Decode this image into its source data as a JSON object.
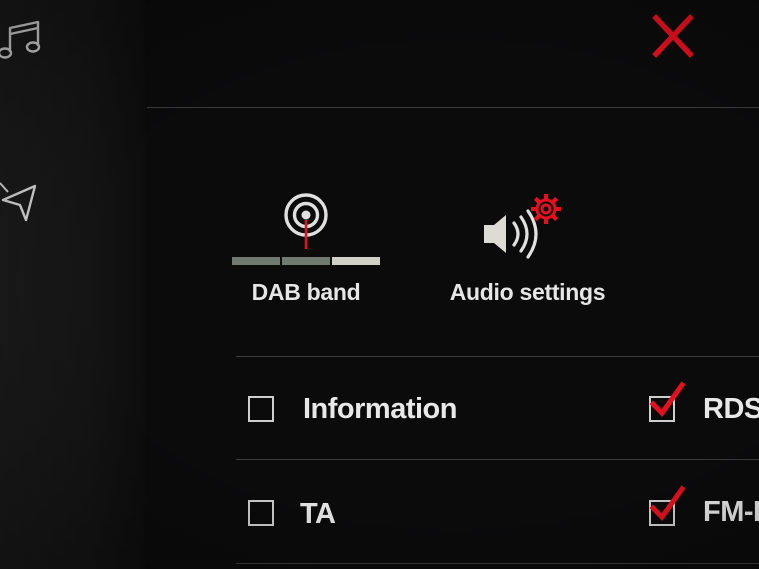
{
  "colors": {
    "accent": "#e3101e",
    "text": "#e8e8e8",
    "divider": "#3c3c3c",
    "background": "#0b0b0c"
  },
  "sidebar": {
    "icons": [
      {
        "name": "music-note-icon"
      },
      {
        "name": "navigation-arrow-icon"
      }
    ]
  },
  "header": {
    "close_icon": "close-icon"
  },
  "tiles": [
    {
      "label": "DAB band",
      "icon": "radio-antenna-icon"
    },
    {
      "label": "Audio settings",
      "icon": "speaker-settings-icon"
    }
  ],
  "options": {
    "information": {
      "label": "Information",
      "checked": false
    },
    "rds": {
      "label": "RDS",
      "checked": true
    },
    "ta": {
      "label": "TA",
      "checked": false
    },
    "fm_dab": {
      "label": "FM-D",
      "checked": true
    }
  }
}
